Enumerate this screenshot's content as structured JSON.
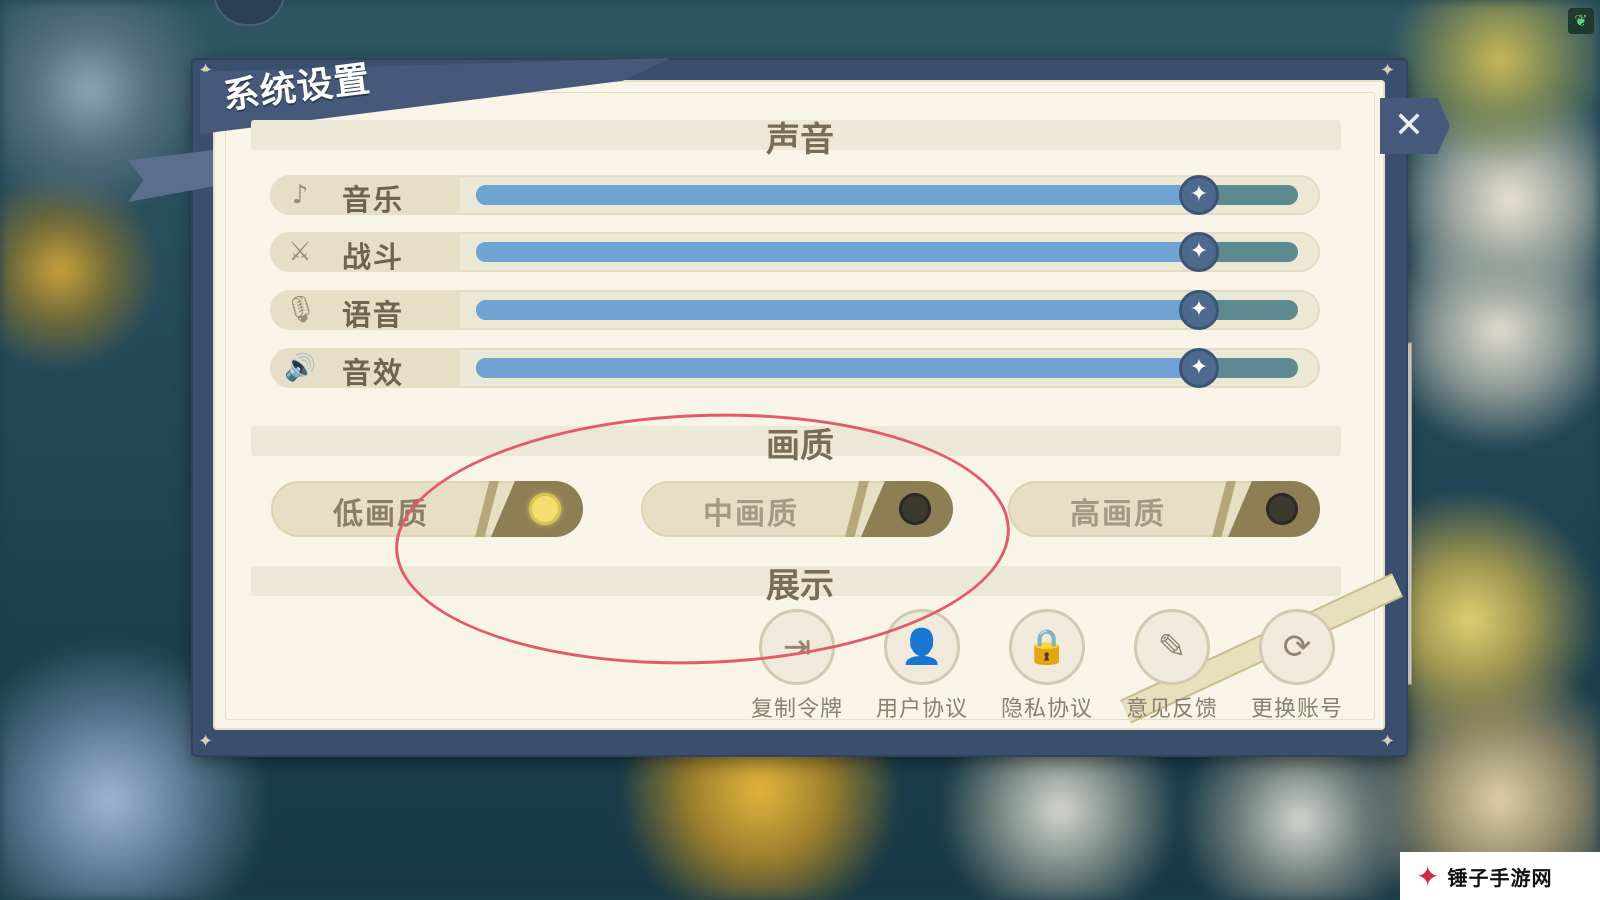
{
  "window": {
    "title": "系统设置"
  },
  "close_button": {
    "glyph": "✕"
  },
  "sections": {
    "sound": "声音",
    "quality": "画质",
    "display": "展示"
  },
  "sliders": [
    {
      "label": "音乐",
      "icon": "music-note-icon",
      "glyph": "♪",
      "value_fraction": 0.88
    },
    {
      "label": "战斗",
      "icon": "crossed-swords-icon",
      "glyph": "⚔",
      "value_fraction": 0.88
    },
    {
      "label": "语音",
      "icon": "microphone-icon",
      "glyph": "🎙",
      "value_fraction": 0.88
    },
    {
      "label": "音效",
      "icon": "speaker-icon",
      "glyph": "🔊",
      "value_fraction": 0.88
    }
  ],
  "quality_options": [
    {
      "label": "低画质",
      "selected": true
    },
    {
      "label": "中画质",
      "selected": false
    },
    {
      "label": "高画质",
      "selected": false
    }
  ],
  "actions": [
    {
      "label": "复制令牌",
      "icon": "copy-token-icon",
      "glyph": "⇥"
    },
    {
      "label": "用户协议",
      "icon": "user-agreement-icon",
      "glyph": "👤"
    },
    {
      "label": "隐私协议",
      "icon": "privacy-lock-icon",
      "glyph": "🔒"
    },
    {
      "label": "意见反馈",
      "icon": "feedback-edit-icon",
      "glyph": "✎"
    },
    {
      "label": "更换账号",
      "icon": "switch-account-icon",
      "glyph": "⟳"
    }
  ],
  "watermark": {
    "text": "锤子手游网"
  },
  "colors": {
    "slider_fill": "#6ea3d3",
    "slider_track": "#5d8a91",
    "panel_bg": "#f8f5e8",
    "frame": "#3a4f6e",
    "annotation": "#e35a6a",
    "selected_dot": "#f4df6e"
  }
}
